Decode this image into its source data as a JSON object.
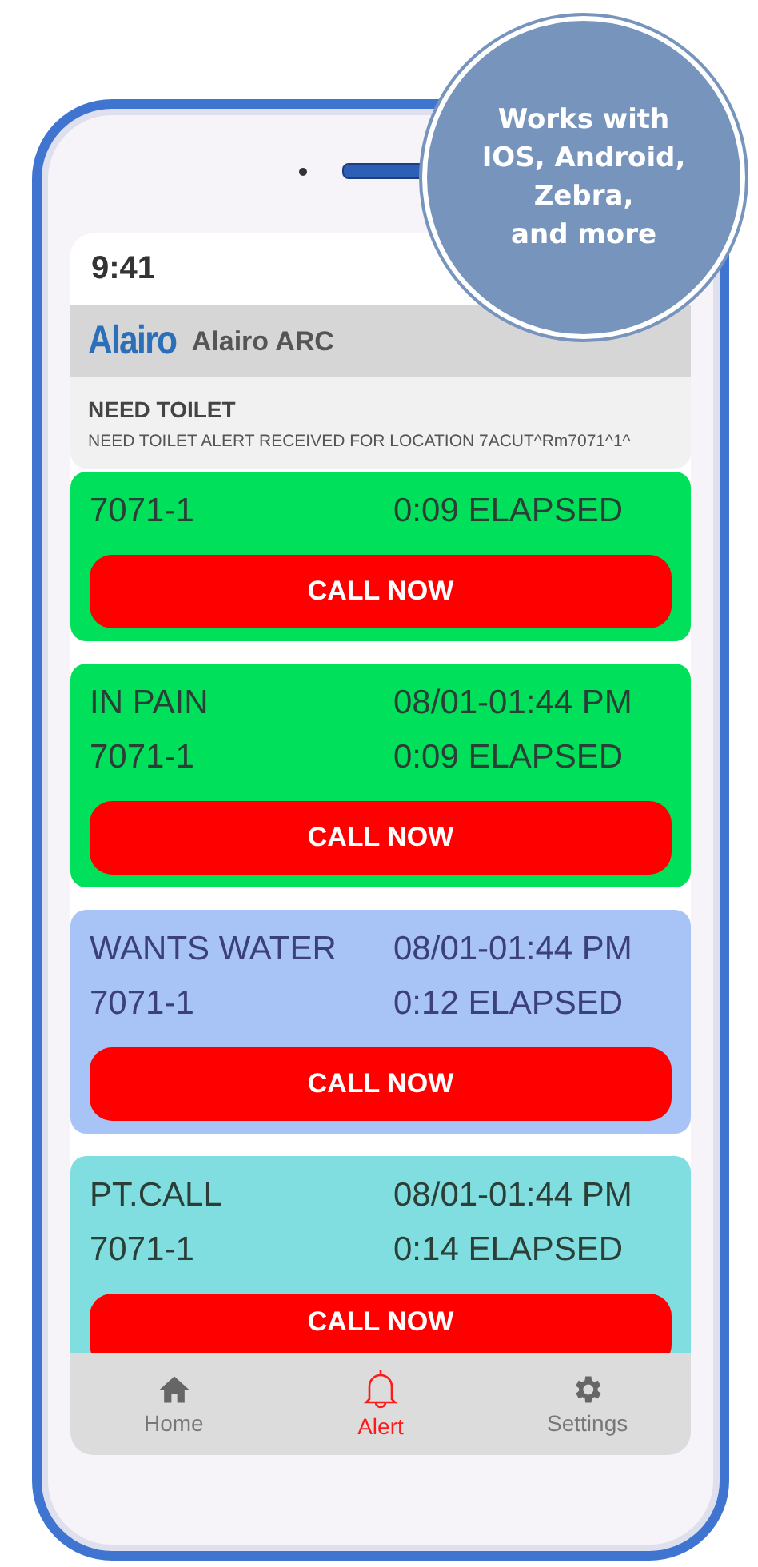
{
  "badge": {
    "lines": [
      "Works with",
      "IOS, Android,",
      "Zebra,",
      "and more"
    ]
  },
  "status_bar": {
    "time": "9:41"
  },
  "app_header": {
    "logo": "Alairo",
    "title": "Alairo ARC"
  },
  "notification": {
    "title": "NEED TOILET",
    "message": "NEED TOILET ALERT RECEIVED FOR LOCATION 7ACUT^Rm7071^1^"
  },
  "alerts": [
    {
      "location": "7071-1",
      "elapsed": "0:09 ELAPSED",
      "color": "#00e05a",
      "button": "CALL NOW"
    },
    {
      "title": "IN PAIN",
      "time": "08/01-01:44 PM",
      "location": "7071-1",
      "elapsed": "0:09 ELAPSED",
      "color": "#00e05a",
      "button": "CALL NOW"
    },
    {
      "title": "WANTS WATER",
      "time": "08/01-01:44 PM",
      "location": "7071-1",
      "elapsed": "0:12 ELAPSED",
      "color": "#a8c3f5",
      "button": "CALL NOW"
    },
    {
      "title": "PT.CALL",
      "time": "08/01-01:44 PM",
      "location": "7071-1",
      "elapsed": "0:14 ELAPSED",
      "color": "#80dde0",
      "button": "CALL NOW"
    }
  ],
  "nav": [
    {
      "label": "Home",
      "kind": "home",
      "selected": false
    },
    {
      "label": "Alert",
      "kind": "alert",
      "selected": true
    },
    {
      "label": "Settings",
      "kind": "settings",
      "selected": false
    }
  ]
}
